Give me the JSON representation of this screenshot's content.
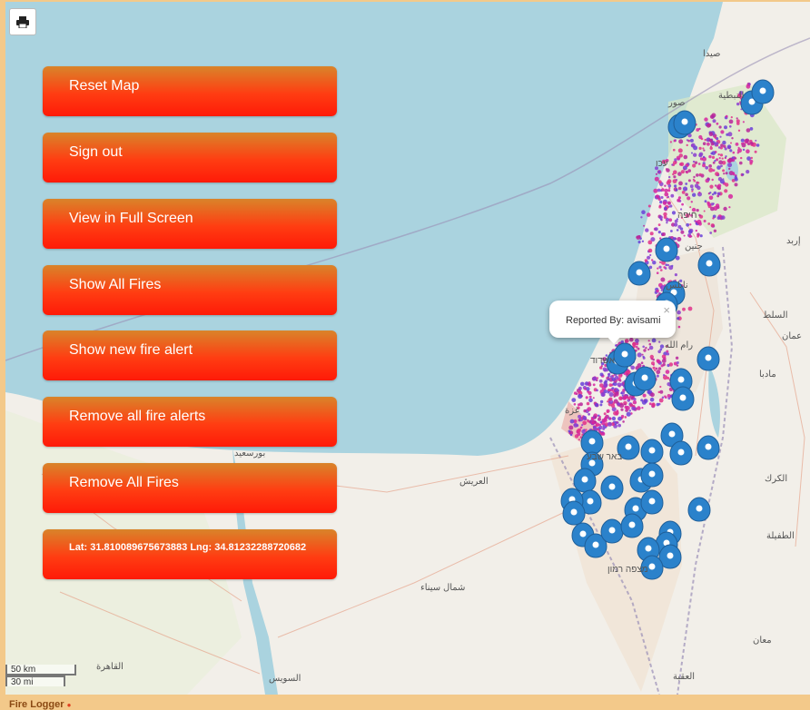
{
  "toolbar": {
    "print_icon": "printer-icon"
  },
  "buttons": {
    "reset_map": "Reset Map",
    "sign_out": "Sign out",
    "full_screen": "View in Full Screen",
    "show_all_fires": "Show All Fires",
    "show_new_alert": "Show new fire alert",
    "remove_alerts": "Remove all fire alerts",
    "remove_fires": "Remove All Fires",
    "coordinates": "Lat: 31.810089675673883 Lng: 34.81232288720682"
  },
  "popup": {
    "text": "Reported By: avisami",
    "close": "×"
  },
  "scale": {
    "metric": "50 km",
    "imperial": "30 mi"
  },
  "footer": {
    "app_name": "Fire Logger"
  },
  "map_labels": {
    "port_said": "بورسعيد",
    "el_arish": "العريش",
    "north_sinai": "شمال سيناء",
    "suez": "السويس",
    "cairo": "القاهرة",
    "beer_sheva": "באר שבע",
    "amman": "عمان",
    "karak": "الكرك",
    "tafilah": "الطفيلة",
    "aqaba": "العقبة",
    "maan": "معان",
    "ramallah": "رام الله",
    "gaza": "غزة",
    "ashdod": "אשדוד",
    "mitzpe_ramon": "מצפה רמון",
    "irbid": "إربد",
    "salt": "السلط",
    "madaba": "مادبا",
    "nablus": "نابلس",
    "jenin": "جنين",
    "haifa": "חיפה",
    "tyre": "صور",
    "acre": "עכו",
    "nabatieh": "النبطية",
    "sidon": "صيدا"
  },
  "colors": {
    "sea": "#aad3df",
    "land": "#f2efe9",
    "button_top": "#d9842a",
    "button_bottom": "#ff1a08",
    "marker": "#2b82cb",
    "fire_magenta": "#d6249f",
    "fire_purple": "#6a3fd8"
  }
}
